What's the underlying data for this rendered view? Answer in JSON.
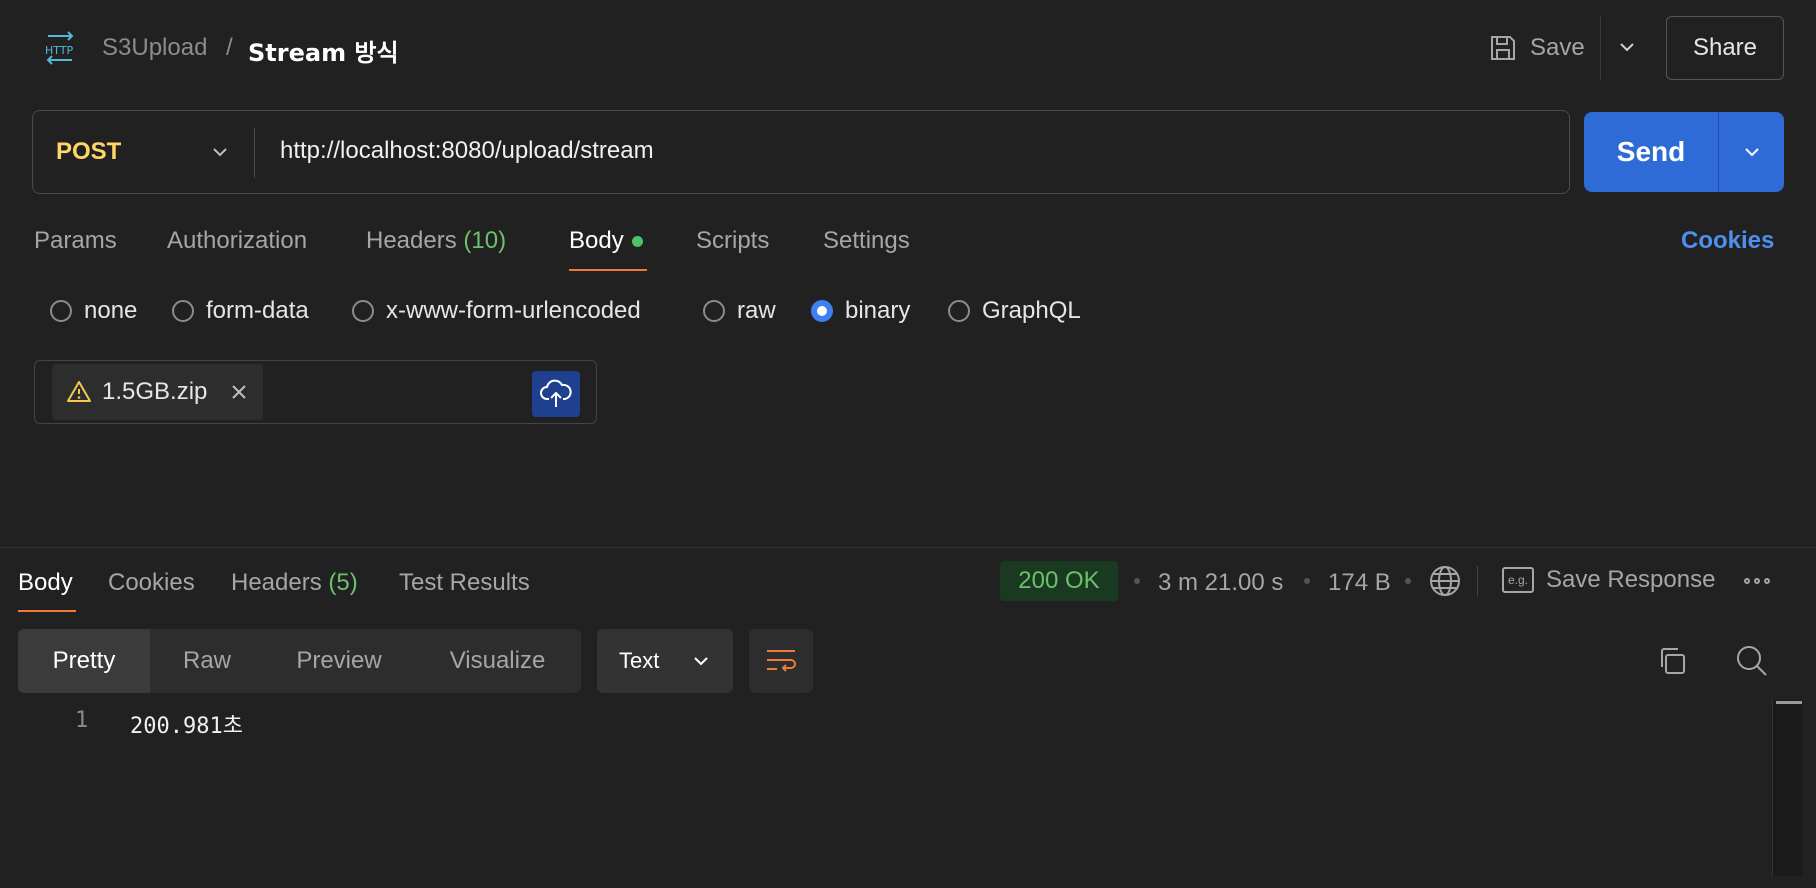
{
  "header": {
    "http_badge": "HTTP",
    "collection": "S3Upload",
    "separator": "/",
    "request_name": "Stream 방식",
    "save_label": "Save",
    "share_label": "Share"
  },
  "request": {
    "method": "POST",
    "url": "http://localhost:8080/upload/stream",
    "send_label": "Send"
  },
  "request_tabs": [
    {
      "label": "Params"
    },
    {
      "label": "Authorization"
    },
    {
      "label": "Headers",
      "count": "(10)"
    },
    {
      "label": "Body"
    },
    {
      "label": "Scripts"
    },
    {
      "label": "Settings"
    }
  ],
  "cookies_label": "Cookies",
  "body_types": [
    {
      "label": "none",
      "checked": false
    },
    {
      "label": "form-data",
      "checked": false
    },
    {
      "label": "x-www-form-urlencoded",
      "checked": false
    },
    {
      "label": "raw",
      "checked": false
    },
    {
      "label": "binary",
      "checked": true
    },
    {
      "label": "GraphQL",
      "checked": false
    }
  ],
  "file": {
    "name": "1.5GB.zip"
  },
  "response": {
    "tabs": [
      {
        "label": "Body"
      },
      {
        "label": "Cookies"
      },
      {
        "label": "Headers",
        "count": "(5)"
      },
      {
        "label": "Test Results"
      }
    ],
    "status": "200 OK",
    "time": "3 m 21.00 s",
    "size": "174 B",
    "save_response_label": "Save Response",
    "eg_label": "e.g.",
    "views": [
      "Pretty",
      "Raw",
      "Preview",
      "Visualize"
    ],
    "format": "Text",
    "lines": [
      {
        "no": "1",
        "text": "200.981초"
      }
    ]
  },
  "colors": {
    "background": "#212121",
    "send": "#2e6bd6",
    "method": "#ffd666",
    "accent": "#f07a3a",
    "status_ok": "#6cc06c",
    "link": "#4f8ff0"
  }
}
